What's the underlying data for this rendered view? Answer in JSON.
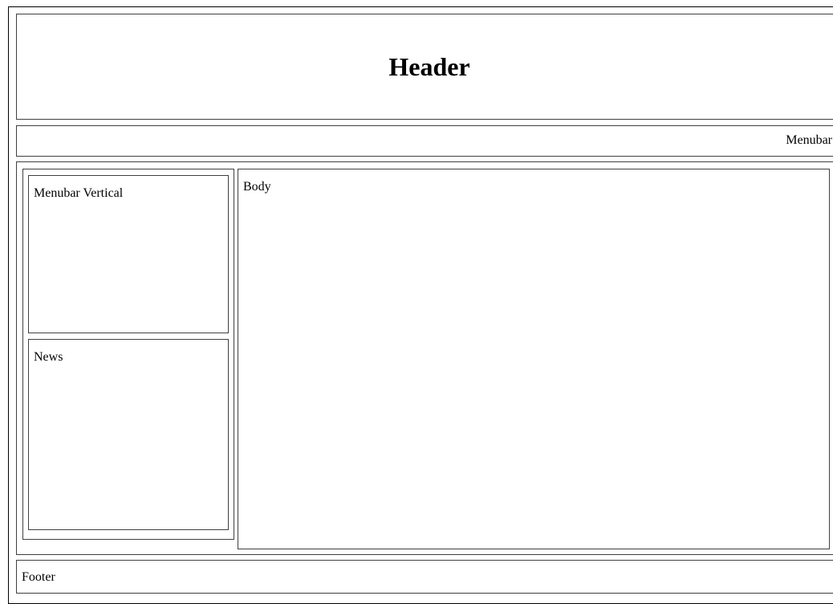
{
  "header": {
    "title": "Header"
  },
  "menubar": {
    "label": "Menubar"
  },
  "sidebar": {
    "vertical_menu": {
      "label": "Menubar Vertical"
    },
    "news": {
      "label": "News"
    }
  },
  "main": {
    "label": "Body"
  },
  "footer": {
    "label": "Footer"
  }
}
